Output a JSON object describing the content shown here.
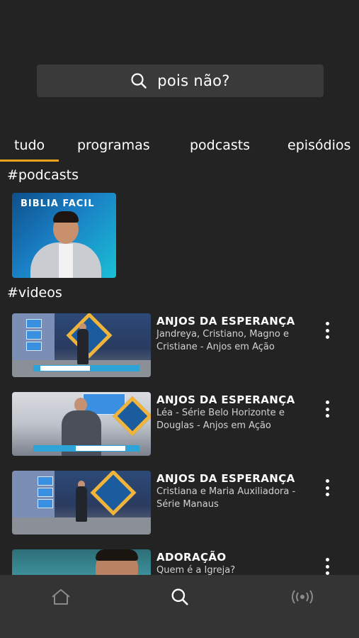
{
  "search": {
    "text": "pois não?",
    "icon": "search-icon"
  },
  "tabs": [
    {
      "label": "tudo",
      "active": true
    },
    {
      "label": "programas",
      "active": false
    },
    {
      "label": "podcasts",
      "active": false
    },
    {
      "label": "episódios",
      "active": false
    }
  ],
  "sections": {
    "podcasts_title": "#podcasts",
    "videos_title": "#videos"
  },
  "podcast": {
    "thumb_text": "BIBLIA FACIL"
  },
  "videos": [
    {
      "title": "ANJOS DA ESPERANÇA",
      "description": "Jandreya, Cristiano, Magno e Cristiane - Anjos em Ação"
    },
    {
      "title": "ANJOS DA ESPERANÇA",
      "description": "Léa - Série Belo Horizonte e Douglas - Anjos em Ação"
    },
    {
      "title": "ANJOS DA ESPERANÇA",
      "description": "Cristiana e Maria Auxiliadora - Série Manaus"
    },
    {
      "title": "ADORAÇÃO",
      "description": "Quem é a Igreja?"
    }
  ],
  "bottom_nav": [
    {
      "icon": "home-icon",
      "active": false
    },
    {
      "icon": "search-icon",
      "active": true
    },
    {
      "icon": "broadcast-icon",
      "active": false
    }
  ],
  "colors": {
    "background": "#232323",
    "accent": "#f0a41d",
    "nav_background": "#343434",
    "search_background": "#3a3a3a"
  }
}
